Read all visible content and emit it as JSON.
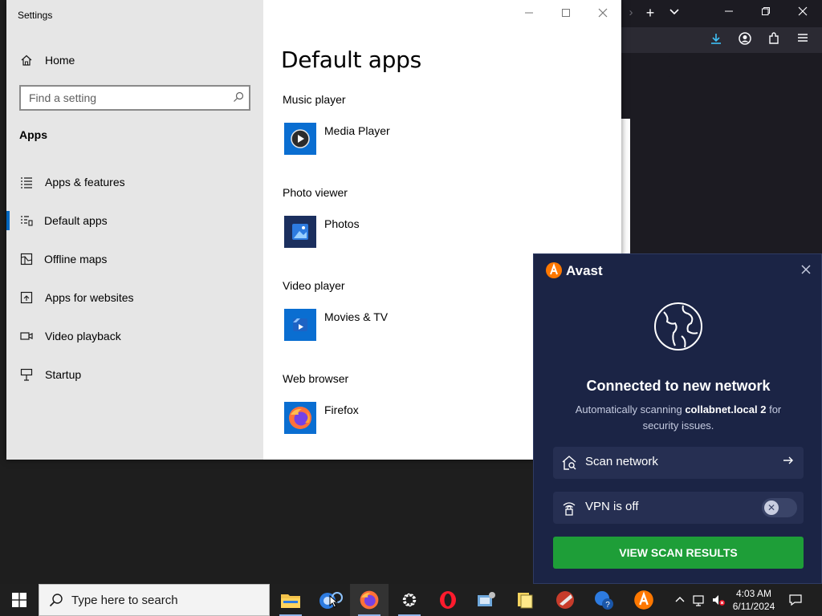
{
  "settings": {
    "window_title": "Settings",
    "home_label": "Home",
    "search_placeholder": "Find a setting",
    "section_heading": "Apps",
    "nav_items": [
      {
        "label": "Apps & features",
        "icon": "list-icon"
      },
      {
        "label": "Default apps",
        "icon": "default-apps-icon",
        "active": true
      },
      {
        "label": "Offline maps",
        "icon": "map-icon"
      },
      {
        "label": "Apps for websites",
        "icon": "apps-websites-icon"
      },
      {
        "label": "Video playback",
        "icon": "video-icon"
      },
      {
        "label": "Startup",
        "icon": "startup-icon"
      }
    ],
    "page_title": "Default apps",
    "defaults": [
      {
        "category": "Music player",
        "app": "Media Player",
        "icon": "media-player-icon"
      },
      {
        "category": "Photo viewer",
        "app": "Photos",
        "icon": "photos-icon"
      },
      {
        "category": "Video player",
        "app": "Movies & TV",
        "icon": "movies-tv-icon"
      },
      {
        "category": "Web browser",
        "app": "Firefox",
        "icon": "firefox-icon"
      }
    ]
  },
  "avast": {
    "brand": "Avast",
    "headline": "Connected to new network",
    "desc_prefix": "Automatically scanning ",
    "network_name": "collabnet.local 2",
    "desc_suffix": " for security issues.",
    "scan_network_label": "Scan network",
    "vpn_label": "VPN is off",
    "vpn_on": false,
    "view_results_label": "VIEW SCAN RESULTS",
    "accent_color": "#1e9e38"
  },
  "taskbar": {
    "search_text": "Type here to search",
    "time": "4:03 AM",
    "date": "6/11/2024"
  }
}
